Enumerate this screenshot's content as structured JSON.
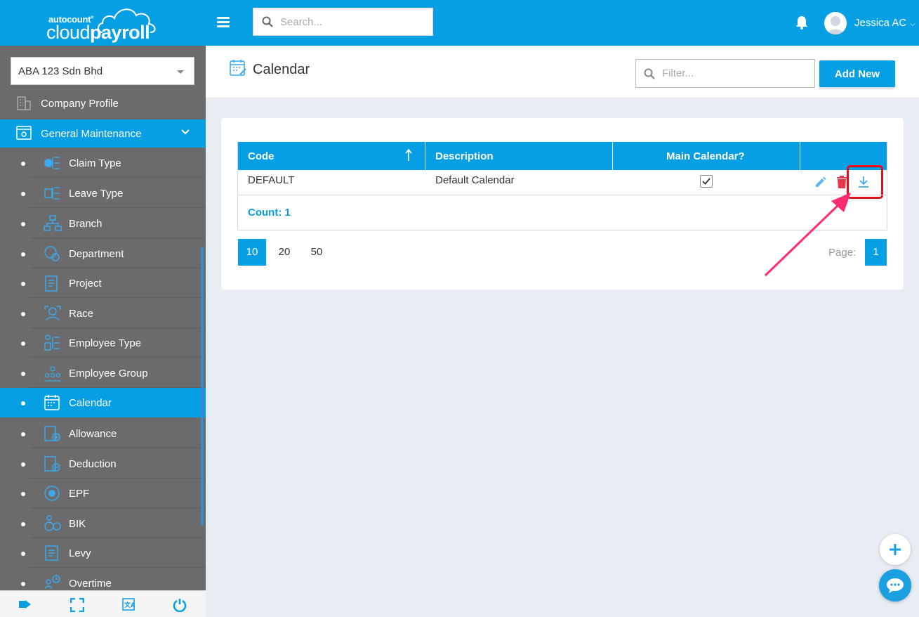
{
  "header": {
    "logo_small": "autocount",
    "logo_cloud": "cloud",
    "logo_payroll": "payroll",
    "search_placeholder": "Search...",
    "user_name": "Jessica AC"
  },
  "sidebar": {
    "company": "ABA 123 Sdn Bhd",
    "top_items": [
      {
        "label": "Company Profile",
        "icon": "building-icon"
      },
      {
        "label": "General Maintenance",
        "icon": "settings-window-icon"
      }
    ],
    "sub_items": [
      {
        "label": "Claim Type",
        "icon": "claim-type-icon"
      },
      {
        "label": "Leave Type",
        "icon": "leave-type-icon"
      },
      {
        "label": "Branch",
        "icon": "branch-icon"
      },
      {
        "label": "Department",
        "icon": "department-icon"
      },
      {
        "label": "Project",
        "icon": "project-icon"
      },
      {
        "label": "Race",
        "icon": "race-icon"
      },
      {
        "label": "Employee Type",
        "icon": "employee-type-icon"
      },
      {
        "label": "Employee Group",
        "icon": "employee-group-icon"
      },
      {
        "label": "Calendar",
        "icon": "calendar-icon"
      },
      {
        "label": "Allowance",
        "icon": "allowance-icon"
      },
      {
        "label": "Deduction",
        "icon": "deduction-icon"
      },
      {
        "label": "EPF",
        "icon": "epf-icon"
      },
      {
        "label": "BIK",
        "icon": "bik-icon"
      },
      {
        "label": "Levy",
        "icon": "levy-icon"
      },
      {
        "label": "Overtime",
        "icon": "overtime-icon"
      }
    ],
    "active_item": "Calendar",
    "footer_icons": [
      "logout-icon",
      "fullscreen-icon",
      "language-icon",
      "power-icon"
    ]
  },
  "main": {
    "title": "Calendar",
    "filter_placeholder": "Filter...",
    "add_button": "Add New",
    "table": {
      "columns": [
        "Code",
        "Description",
        "Main Calendar?",
        ""
      ],
      "rows": [
        {
          "code": "DEFAULT",
          "description": "Default Calendar",
          "main_calendar": true
        }
      ]
    },
    "count_label": "Count: 1",
    "page_sizes": [
      "10",
      "20",
      "50"
    ],
    "selected_page_size": "10",
    "page_label": "Page:",
    "current_page": "1"
  },
  "colors": {
    "primary": "#069fe3",
    "sidebar": "#6b6b6b",
    "delete": "#e8374b",
    "highlight": "#e0101a",
    "arrow": "#ff2d6f"
  }
}
